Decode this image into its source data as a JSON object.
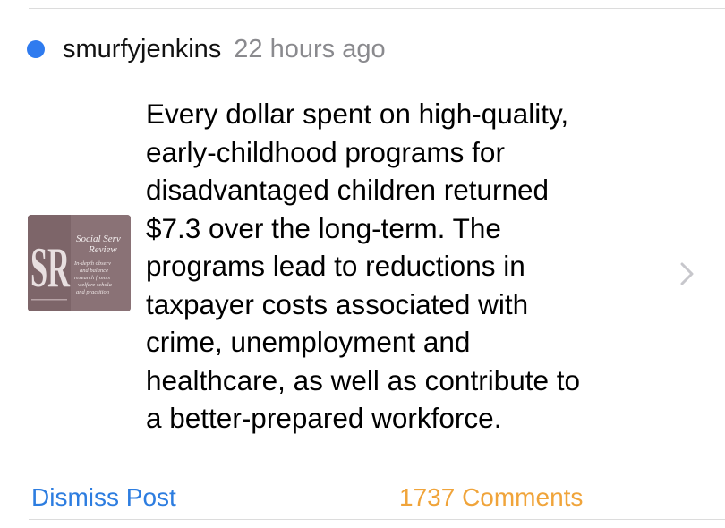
{
  "post": {
    "username": "smurfyjenkins",
    "time": "22 hours ago",
    "unread_color": "#2f7bef",
    "body": "Every dollar spent on high-quality,\nearly-childhood programs for\ndisadvantaged children returned\n$7.3 over the long-term. The\nprograms lead to reductions in\ntaxpayer costs associated with\ncrime, unemployment and\nhealthcare, as well as contribute to\na better-prepared workforce.",
    "thumbnail": {
      "title_line1": "Social Serv",
      "title_line2": "Review",
      "logo_letters": "SR",
      "tagline": [
        "In-depth observ",
        "and balance",
        "research from s",
        "welfare schola",
        "and practition"
      ],
      "background_color": "#8a7276"
    },
    "chevron_icon": "chevron-right-icon"
  },
  "actions": {
    "dismiss_label": "Dismiss Post",
    "dismiss_color": "#2d7de0",
    "comments_label": "1737 Comments",
    "comments_color": "#f0a43a"
  }
}
